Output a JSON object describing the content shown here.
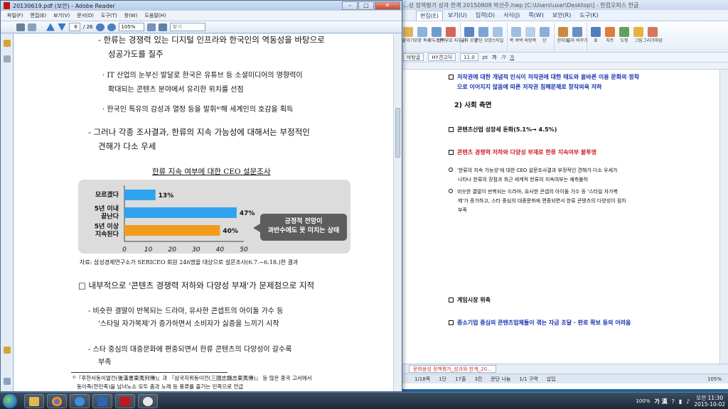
{
  "hwp": {
    "title": "...성 정책평가 성과 한계 20150808 박선주.hwp [C:\\Users\\user\\Desktop\\] - 한컴오피스 한글",
    "menus": [
      "편집(E)",
      "보기(U)",
      "입력(D)",
      "서식(J)",
      "쪽(W)",
      "보안(R)",
      "도구(K)"
    ],
    "ribbon_groups": [
      {
        "label": "",
        "buttons": [
          "붙이기",
          "모양 복사",
          "모두 선택",
          "조판 부호 지우기"
        ]
      },
      {
        "label": "서식",
        "buttons": [
          "글자 모양",
          "문단 모양",
          "스타일"
        ]
      },
      {
        "label": "",
        "buttons": [
          "쪽 여백",
          "바탕쪽",
          "단"
        ]
      },
      {
        "label": "글자 바꾸기",
        "buttons": [
          "한자로",
          "글자 바꾸기"
        ]
      },
      {
        "label": "입력",
        "buttons": [
          "표",
          "차트",
          "도형",
          "그림",
          "그리기마당"
        ]
      }
    ],
    "format_bar": {
      "style": "바탕글",
      "font": "HY견고딕",
      "size": "11.0",
      "unit": "pt"
    },
    "lines": [
      "저작권에 대한 개념적 인식이 저작권에 대한 태도와 올바른 이용 문화의 정착",
      "으로 이어지지 않음에 따른 저작권 침해문제로 창작의욕 저하",
      "2) 사회 측면",
      "콘텐츠산업 성장세 둔화(5.1%→ 4.5%)",
      "콘텐츠 경쟁력 저하와 다양성 부재로 한류 지속여부 불투명",
      "'한류의 지속 가능성'에 대한 CEO 설문조사결과 부정적인 견해가 다소 우세가",
      "나타나 한류의 장점과 최근 세계적 한류의 지속여부는 예측불허",
      "비슷한 결말이 반복되는 드라마, 유사한 콘셉의 아이돌 가수 등 '스타일 자가복",
      "제'가 증가하고, 스타 중심의 대중문화에 편중되면서 한류 콘텐츠의 다양성이 점차",
      "부족",
      "게임시장 위축",
      "중소기업 중심의 콘텐츠업체들이 겪는 자금 조달 · 판로 확보 등의 어려움"
    ],
    "tab_label": "문화융성 정책평가_성과와 한계_20...",
    "status": [
      "1/18쪽",
      "1단",
      "17줄",
      "3칸",
      "문단 나눔",
      "1/1 구역",
      "삽입"
    ],
    "zoom": "105%"
  },
  "reader": {
    "title": "20130619.pdf (보안) - Adobe Reader",
    "menus": [
      "파일(F)",
      "편집(E)",
      "보기(V)",
      "문서(D)",
      "도구(T)",
      "창(W)",
      "도움말(H)"
    ],
    "page_current": "6",
    "page_total": "/ 26",
    "zoom": "105%",
    "find_placeholder": "찾기",
    "body": [
      "- 한류는 경쟁력 있는 디지털 인프라와 한국인의 역동성을 바탕으로",
      "성공가도를 질주",
      "· IT 산업의 눈부신 발달로 한국은 유튜브 등 소셜미디어의 영향력이",
      "확대되는 콘텐츠 분야에서 유리한 위치를 선점",
      "· 한국인 특유의 감성과 열정 등을 발휘⁴⁾해 세계인의 호감을 획득",
      "- 그러나 각종 조사결과, 한류의 지속 가능성에 대해서는 부정적인",
      "견해가 다소 우세"
    ],
    "source": "자료: 삼성경제연구소가 SERICEO 회원 246명을 대상으로 설문조사(6.7.~6.18.)한 결과",
    "body2": [
      "□ 내부적으로 '콘텐츠 경쟁력 저하와 다양성 부재'가 문제점으로 지적",
      "- 비슷한 결말이 반복되는 드라마, 유사한 콘셉트의 아이돌 가수 등",
      "'스타일 자가복제'가 증가하면서 소비자가 싫증을 느끼기 시작",
      "- 스타 중심의 대중문화에 편중되면서 한류 콘텐츠의 다양성이 갈수록",
      "부족"
    ],
    "footnote": [
      "⁴⁾『후한서동이열전(後漢書東夷列傳)』과 『삼국지위동이전(三國志魏志東夷傳)』 등 많은 중국 고서에서",
      "동이족(한민족)을 남녀노소 모두 춤과 노래 등 풍류를 즐기는 민족으로 언급"
    ]
  },
  "chart_data": {
    "type": "bar",
    "title": "한류 지속 여부에 대한 CEO 설문조사",
    "categories": [
      "모르겠다",
      "5년 이내\n끝난다",
      "5년 이상\n지속된다"
    ],
    "values": [
      13,
      47,
      40
    ],
    "value_labels": [
      "13%",
      "47%",
      "40%"
    ],
    "xlim": [
      0,
      50
    ],
    "xticks": [
      0,
      10,
      20,
      30,
      40,
      50
    ],
    "colors": [
      "#2fa3ee",
      "#2fa3ee",
      "#f39b1d"
    ],
    "annotation": "긍정적 전망이\n과반수에도 못 미치는 상태"
  },
  "taskbar": {
    "apps": [
      "explorer",
      "media",
      "chrome",
      "ie",
      "hancom",
      "acrobat",
      "messenger"
    ],
    "tray_lang": "가 漢",
    "time": "오전 11:30",
    "date": "2015-10-02",
    "zoom_status": "100%"
  }
}
